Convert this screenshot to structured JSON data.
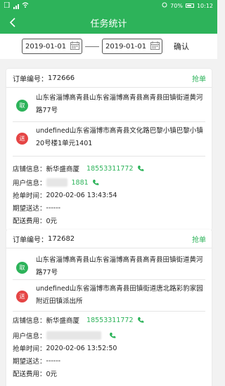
{
  "status_bar": {
    "battery": "70%",
    "time": "10:12"
  },
  "header": {
    "title": "任务统计"
  },
  "filter": {
    "start_date": "2019-01-01",
    "end_date": "2019-01-01",
    "confirm": "确认"
  },
  "orders": [
    {
      "order_label": "订单编号：",
      "order_no": "172666",
      "action": "抢单",
      "pickup_badge": "取",
      "pickup_address": "山东省淄博高青县山东省淄博高青县高青县田镇街道黄河路77号",
      "delivery_badge": "送",
      "delivery_address": "undefined山东省淄博市高青县文化路巴黎小镇巴黎小镇20号楼1单元1401",
      "store_label": "店铺信息：",
      "store_name": "新华盛商厦",
      "store_phone": "18553311772",
      "user_label": "用户信息：",
      "user_phone": "1881",
      "grab_time_label": "抢单时间：",
      "grab_time": "2020-02-06 13:43:54",
      "expected_label": "期望送达：",
      "expected": "------",
      "fee_label": "配送费用：",
      "fee": "0元"
    },
    {
      "order_label": "订单编号：",
      "order_no": "172682",
      "action": "抢单",
      "pickup_badge": "取",
      "pickup_address": "山东省淄博高青县山东省淄博高青县高青县田镇街道黄河路77号",
      "delivery_badge": "送",
      "delivery_address": "undefined山东省淄博市高青县田镇街道唐北路彩豹家园附近田镇派出所",
      "store_label": "店铺信息：",
      "store_name": "新华盛商厦",
      "store_phone": "18553311772",
      "user_label": "用户信息：",
      "user_phone": "",
      "grab_time_label": "抢单时间：",
      "grab_time": "2020-02-06 13:52:50",
      "expected_label": "期望送达：",
      "expected": "------",
      "fee_label": "配送费用：",
      "fee": "0元"
    }
  ],
  "colors": {
    "primary": "#2db35a",
    "delivery": "#e54545"
  },
  "icons": [
    "back-arrow-icon",
    "calendar-icon",
    "phone-icon"
  ]
}
